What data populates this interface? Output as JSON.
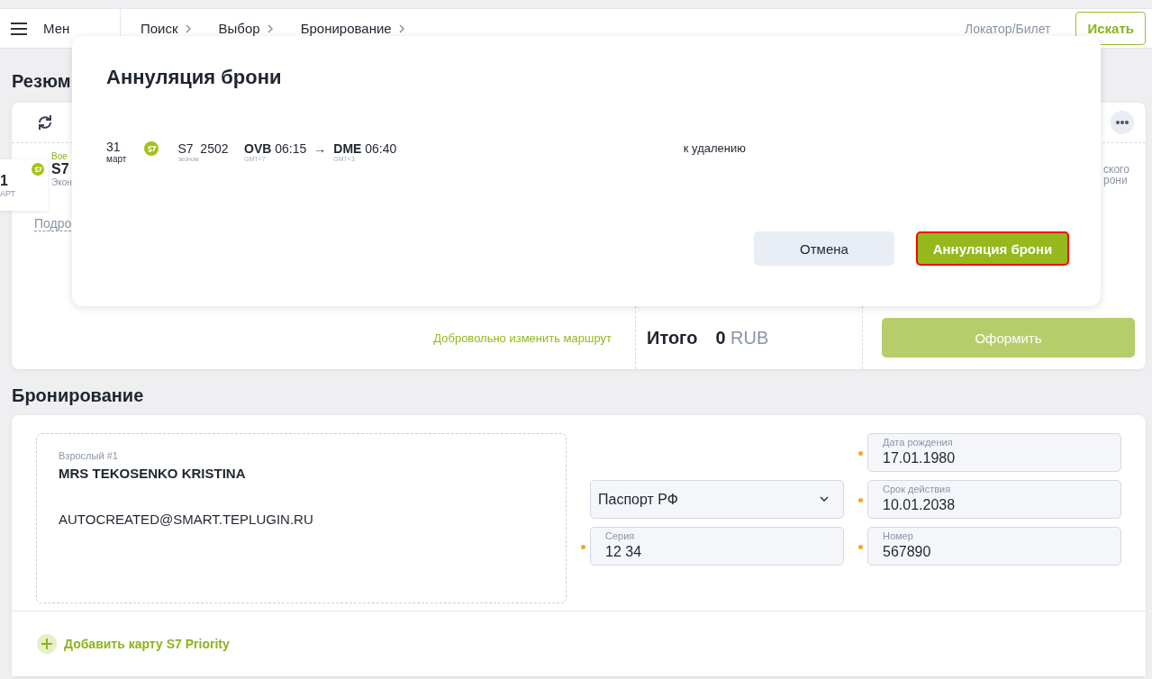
{
  "header": {
    "menu_label": "Мен",
    "breadcrumbs": [
      "Поиск",
      "Выбор",
      "Бронирование"
    ],
    "locator_placeholder": "Локатор/Билет",
    "search_button": "Искать"
  },
  "summary": {
    "title": "Резюм",
    "segment": {
      "day": "1",
      "month": "АРТ",
      "aircraft": "Вое",
      "carrier": "S7",
      "cabin": "Экон",
      "details_link": "Подро",
      "side_lines": [
        "ского",
        "рони"
      ]
    },
    "footer": {
      "change_route_link": "Добровольно изменить маршрут",
      "total_label": "Итого",
      "total_amount": "0",
      "currency": "RUB",
      "checkout_button": {
        "label": "Оформить",
        "disabled": true
      }
    }
  },
  "booking": {
    "title": "Бронирование",
    "passenger": {
      "type_label": "Взрослый #1",
      "name": "MRS TEKOSENKO KRISTINA",
      "email": "AUTOCREATED@SMART.TEPLUGIN.RU"
    },
    "document_type": "Паспорт РФ",
    "fields": [
      {
        "label": "Дата рождения",
        "value": "17.01.1980",
        "required": true
      },
      {
        "label": "Срок действия",
        "value": "10.01.2038",
        "required": true
      },
      {
        "label": "Серия",
        "value": "12 34",
        "required": true
      },
      {
        "label": "Номер",
        "value": "567890",
        "required": true
      }
    ],
    "add_card": "Добавить карту S7 Priority"
  },
  "modal": {
    "title": "Аннуляция брони",
    "flight": {
      "day": "31",
      "month": "март",
      "carrier": "S7",
      "number": "2502",
      "cabin": "эконом",
      "from": {
        "code": "OVB",
        "time": "06:15",
        "tz": "GMT+7"
      },
      "arrow": "→",
      "to": {
        "code": "DME",
        "time": "06:40",
        "tz": "GMT+3"
      },
      "status": "к удалению"
    },
    "buttons": [
      {
        "label": "Отмена",
        "kind": "secondary",
        "focused": false
      },
      {
        "label": "Аннуляция брони",
        "kind": "primary",
        "focused": true
      }
    ]
  }
}
